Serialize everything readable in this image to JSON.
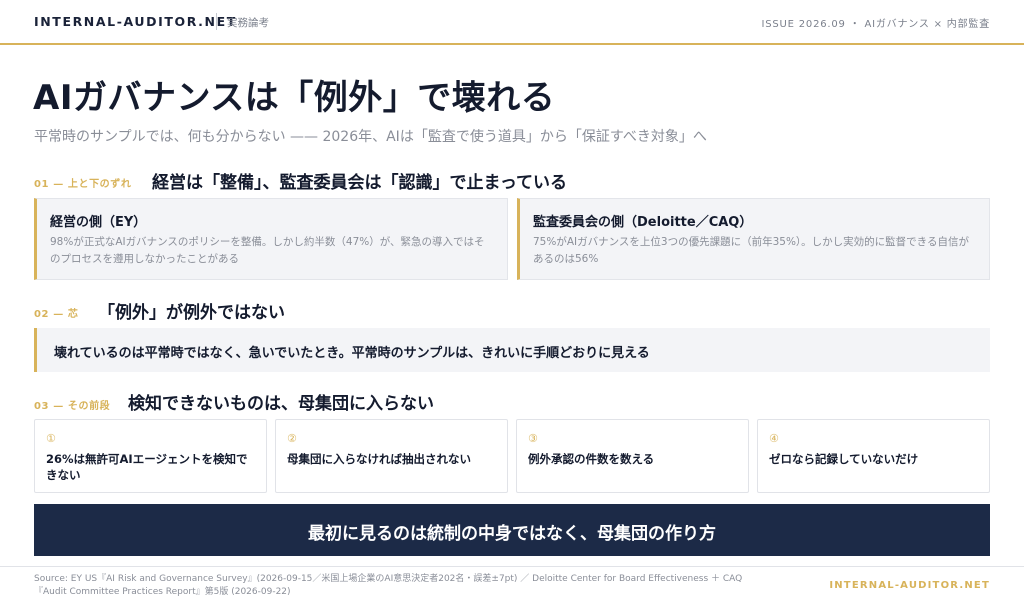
{
  "header": {
    "brand": "INTERNAL-AUDITOR.NET",
    "section": "実務論考",
    "issue": "ISSUE 2026.09 ・ AIガバナンス × 内部監査"
  },
  "headline": "AIガバナンスは「例外」で壊れる",
  "subhead": "平常時のサンプルでは、何も分からない —— 2026年、AIは「監査で使う道具」から「保証すべき対象」へ",
  "section1": {
    "label": "01 — 上と下のずれ",
    "title": "経営は「整備」、監査委員会は「認識」で止まっている",
    "cards": [
      {
        "title": "経営の側（EY）",
        "body": "98%が正式なAIガバナンスのポリシーを整備。しかし約半数（47%）が、緊急の導入ではそのプロセスを遵用しなかったことがある"
      },
      {
        "title": "監査委員会の側（Deloitte／CAQ）",
        "body": "75%がAIガバナンスを上位3つの優先課題に（前年35%）。しかし実効的に監督できる自信があるのは56%"
      }
    ]
  },
  "section2": {
    "label": "02 — 芯",
    "title": "「例外」が例外ではない",
    "callout": "壊れているのは平常時ではなく、急いでいたとき。平常時のサンプルは、きれいに手順どおりに見える"
  },
  "section3": {
    "label": "03 — その前段",
    "title": "検知できないものは、母集団に入らない",
    "steps": [
      {
        "num": "①",
        "text": "26%は無許可AIエージェントを検知できない"
      },
      {
        "num": "②",
        "text": "母集団に入らなければ抽出されない"
      },
      {
        "num": "③",
        "text": "例外承認の件数を数える"
      },
      {
        "num": "④",
        "text": "ゼロなら記録していないだけ"
      }
    ]
  },
  "banner": "最初に見るのは統制の中身ではなく、母集団の作り方",
  "footer": {
    "source": "Source: EY US『AI Risk and Governance Survey』(2026-09-15／米国上場企業のAI意思決定者202名・誤差±7pt) ／ Deloitte Center for Board Effectiveness ＋ CAQ『Audit Committee Practices Report』第5版 (2026-09-22)",
    "brand": "INTERNAL-AUDITOR.NET"
  },
  "colors": {
    "accent": "#d8b35a",
    "navy": "#1c2a47",
    "text": "#141b2e",
    "muted": "#8a8e98",
    "card_bg": "#f3f4f7"
  }
}
